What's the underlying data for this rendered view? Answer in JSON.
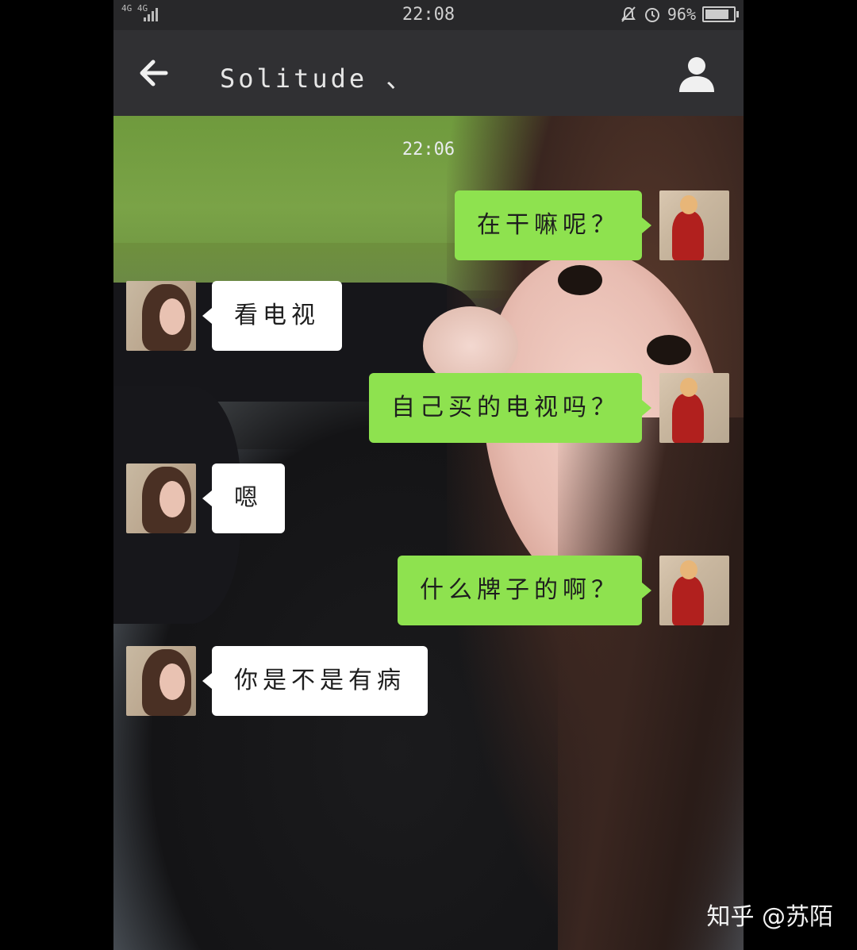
{
  "status_bar": {
    "network": "4G 4G",
    "time": "22:08",
    "battery_percent": "96%",
    "battery_level": 0.96,
    "icons": [
      "mute-icon",
      "alarm-icon",
      "battery-icon"
    ]
  },
  "header": {
    "title": "Solitude 、",
    "back_icon": "back-arrow-icon",
    "contact_icon": "person-icon"
  },
  "chat": {
    "timestamp": "22:06",
    "messages": [
      {
        "sender": "me",
        "text": "在干嘛呢？"
      },
      {
        "sender": "her",
        "text": "看电视"
      },
      {
        "sender": "me",
        "text": "自己买的电视吗？"
      },
      {
        "sender": "her",
        "text": "嗯"
      },
      {
        "sender": "me",
        "text": "什么牌子的啊？"
      },
      {
        "sender": "her",
        "text": "你是不是有病"
      }
    ]
  },
  "watermark": "知乎 @苏陌",
  "colors": {
    "outgoing_bubble": "#8ee24f",
    "incoming_bubble": "#ffffff",
    "title_bar": "#303033"
  }
}
